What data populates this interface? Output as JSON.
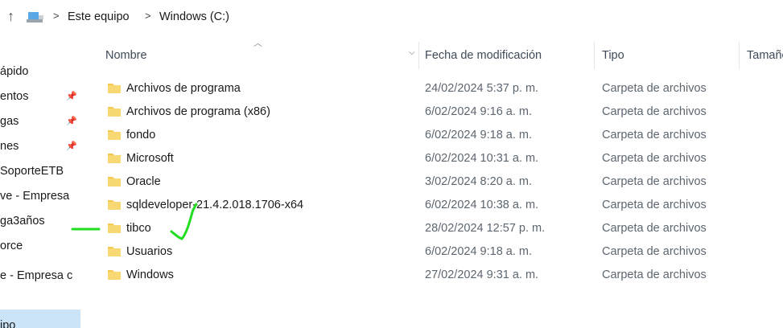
{
  "address_bar": {
    "crumbs": [
      "Este equipo",
      "Windows (C:)"
    ],
    "separator": ">"
  },
  "nav_pane": {
    "items": [
      {
        "label": "ápido",
        "pinned": false,
        "selected": false
      },
      {
        "label": "entos",
        "pinned": true,
        "selected": false
      },
      {
        "label": "gas",
        "pinned": true,
        "selected": false
      },
      {
        "label": "nes",
        "pinned": true,
        "selected": false
      },
      {
        "label": "SoporteETB",
        "pinned": false,
        "selected": false
      },
      {
        "label": "ve - Empresa",
        "pinned": false,
        "selected": false
      },
      {
        "label": "ga3años",
        "pinned": false,
        "selected": false
      },
      {
        "label": "orce",
        "pinned": false,
        "selected": false
      },
      {
        "label": "e - Empresa c",
        "pinned": false,
        "selected": false
      },
      {
        "label": "ipo",
        "pinned": false,
        "selected": true
      }
    ]
  },
  "columns": {
    "name": "Nombre",
    "date": "Fecha de modificación",
    "type": "Tipo",
    "size": "Tamaño"
  },
  "rows": [
    {
      "name": "Archivos de programa",
      "date": "24/02/2024 5:37 p. m.",
      "type": "Carpeta de archivos"
    },
    {
      "name": "Archivos de programa (x86)",
      "date": "6/02/2024 9:16 a. m.",
      "type": "Carpeta de archivos"
    },
    {
      "name": "fondo",
      "date": "6/02/2024 9:18 a. m.",
      "type": "Carpeta de archivos"
    },
    {
      "name": "Microsoft",
      "date": "6/02/2024 10:31 a. m.",
      "type": "Carpeta de archivos"
    },
    {
      "name": "Oracle",
      "date": "3/02/2024 8:20 a. m.",
      "type": "Carpeta de archivos"
    },
    {
      "name": "sqldeveloper-21.4.2.018.1706-x64",
      "date": "6/02/2024 10:38 a. m.",
      "type": "Carpeta de archivos"
    },
    {
      "name": "tibco",
      "date": "28/02/2024 12:57 p. m.",
      "type": "Carpeta de archivos"
    },
    {
      "name": "Usuarios",
      "date": "6/02/2024 9:18 a. m.",
      "type": "Carpeta de archivos"
    },
    {
      "name": "Windows",
      "date": "27/02/2024 9:31 a. m.",
      "type": "Carpeta de archivos"
    }
  ],
  "icons": {
    "up": "up-arrow-icon",
    "drive": "computer-drive-icon",
    "folder": "folder-icon",
    "pin": "pin-icon",
    "sort": "sort-ascending-icon",
    "dropdown": "chevron-down-icon"
  },
  "colors": {
    "selection": "#cce4f7",
    "folder": "#f5c84c",
    "annotation": "#22dd22"
  }
}
